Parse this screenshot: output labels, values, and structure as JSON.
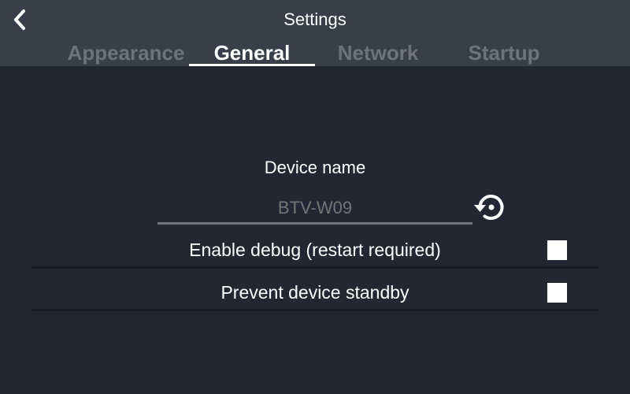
{
  "header": {
    "title": "Settings",
    "back_icon": "chevron-left-icon"
  },
  "tabs": [
    {
      "label": "Appearance",
      "active": false
    },
    {
      "label": "General",
      "active": true
    },
    {
      "label": "Network",
      "active": false
    },
    {
      "label": "Startup",
      "active": false
    }
  ],
  "general": {
    "device_name_label": "Device name",
    "device_name_placeholder": "BTV-W09",
    "device_name_value": "",
    "reset_icon": "restore-icon",
    "options": [
      {
        "label": "Enable debug (restart required)",
        "checked": false
      },
      {
        "label": "Prevent device standby",
        "checked": false
      }
    ]
  },
  "colors": {
    "background": "#232733",
    "header": "#393e4b",
    "active_tab": "#ffffff",
    "inactive_tab": "#6e727d",
    "input_line": "#6f737c",
    "divider": "#191c24"
  }
}
